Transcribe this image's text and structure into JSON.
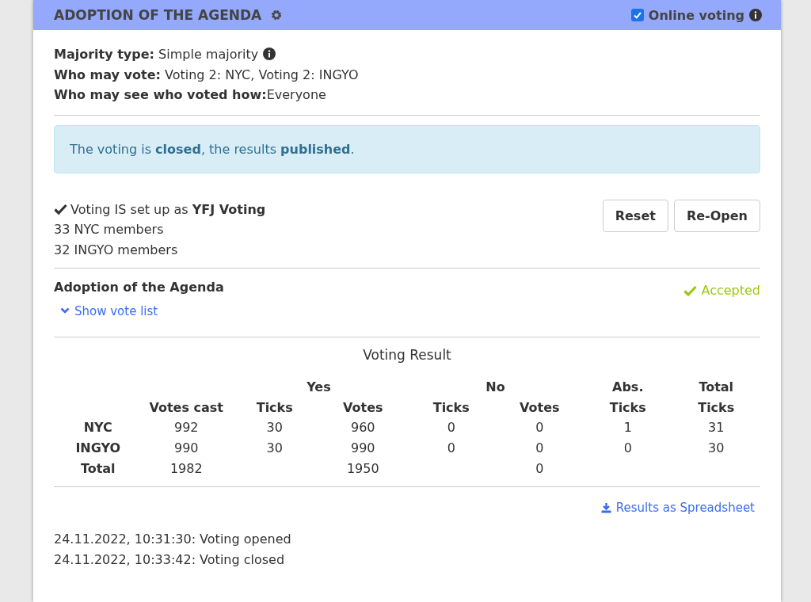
{
  "header": {
    "title": "ADOPTION OF THE AGENDA",
    "online_voting": {
      "label": "Online voting",
      "checked": true
    }
  },
  "info": [
    {
      "text": "**Majority type:** Simple majority",
      "info_icon": true
    },
    {
      "text": "**Who may vote:** Voting 2: NYC, Voting 2: INGYO",
      "info_icon": false
    },
    {
      "text": "**Who may see who voted how:**Everyone",
      "info_icon": false
    }
  ],
  "alert": "The voting is **closed**, the results **published**.",
  "setup": {
    "status": "Voting IS set up as **YFJ Voting**",
    "members": [
      "33 NYC members",
      "32 INGYO members"
    ],
    "buttons": [
      "Reset",
      "Re-Open"
    ]
  },
  "motion": {
    "title": "Adoption of the Agenda",
    "result": "Accepted",
    "show_vote_list": "Show vote list"
  },
  "results": {
    "title": "Voting Result",
    "groups": [
      {
        "columns": [
          "Votes cast"
        ]
      },
      {
        "label": "Yes",
        "columns": [
          "Ticks",
          "Votes"
        ]
      },
      {
        "label": "No",
        "columns": [
          "Ticks",
          "Votes"
        ]
      },
      {
        "label": "Abs.",
        "columns": [
          "Ticks"
        ]
      },
      {
        "label": "Total",
        "columns": [
          "Ticks"
        ]
      }
    ],
    "rows": [
      {
        "label": "NYC",
        "cells": [
          "992",
          "30",
          "960",
          "0",
          "0",
          "1",
          "31"
        ]
      },
      {
        "label": "INGYO",
        "cells": [
          "990",
          "30",
          "990",
          "0",
          "0",
          "0",
          "30"
        ]
      },
      {
        "label": "Total",
        "cells": [
          "1982",
          null,
          "1950",
          null,
          "0",
          null,
          null
        ]
      }
    ]
  },
  "download_link": "Results as Spreadsheet",
  "log": [
    "24.11.2022, 10:31:30: Voting opened",
    "24.11.2022, 10:33:42: Voting closed"
  ]
}
